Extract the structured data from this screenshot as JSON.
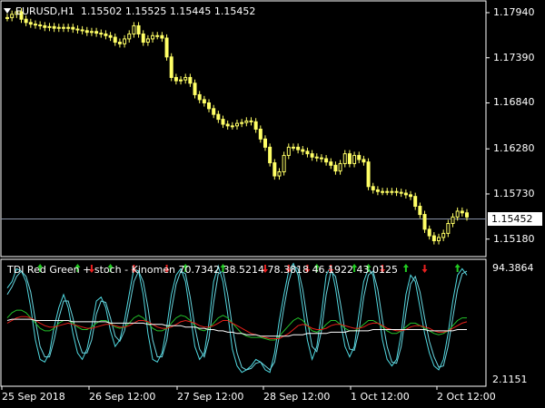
{
  "header": {
    "symbol_timeframe": "EURUSD,H1",
    "ohlc": "1.15502 1.15525 1.15445 1.15452",
    "current_price": "1.15452"
  },
  "price_axis": {
    "ticks": [
      "1.17940",
      "1.17390",
      "1.16840",
      "1.16280",
      "1.15730",
      "1.15180"
    ]
  },
  "indicator": {
    "title": "TDI Red Green + stoch - Kinomen 70.7342 38.5214 78.3818 46.1922 43.0125",
    "axis_top": "94.3864",
    "axis_bottom": "2.1151"
  },
  "time_axis": {
    "labels": [
      "25 Sep 2018",
      "26 Sep 12:00",
      "27 Sep 12:00",
      "28 Sep 12:00",
      "1 Oct 12:00",
      "2 Oct 12:00"
    ]
  },
  "colors": {
    "background": "#000000",
    "candles": "#ffff66",
    "fast_line": "#4fd8e0",
    "slow_line": "#6ad6e0",
    "green_line": "#22c22a",
    "red_line": "#e8201a",
    "white_line": "#ffffff",
    "up_arrow": "#22cc22",
    "down_arrow": "#e82020"
  },
  "chart_data": {
    "type": "candlestick",
    "symbol": "EURUSD",
    "timeframe": "H1",
    "close_series": [
      1.1788,
      1.1792,
      1.1795,
      1.1786,
      1.1782,
      1.178,
      1.1779,
      1.1778,
      1.1776,
      1.1777,
      1.1775,
      1.1776,
      1.1775,
      1.1776,
      1.1774,
      1.1773,
      1.1772,
      1.177,
      1.1771,
      1.1769,
      1.1768,
      1.1766,
      1.1764,
      1.1758,
      1.1756,
      1.1762,
      1.1768,
      1.1778,
      1.1768,
      1.1758,
      1.1762,
      1.1766,
      1.1766,
      1.1763,
      1.174,
      1.1715,
      1.1711,
      1.1712,
      1.1715,
      1.1708,
      1.1694,
      1.1688,
      1.1684,
      1.1677,
      1.167,
      1.1664,
      1.1658,
      1.1656,
      1.1656,
      1.1659,
      1.166,
      1.1662,
      1.1661,
      1.1652,
      1.164,
      1.163,
      1.1611,
      1.1595,
      1.16,
      1.162,
      1.163,
      1.163,
      1.1627,
      1.1625,
      1.1622,
      1.1618,
      1.1617,
      1.1616,
      1.1612,
      1.1608,
      1.1601,
      1.161,
      1.1622,
      1.161,
      1.162,
      1.1615,
      1.1612,
      1.1582,
      1.1578,
      1.1576,
      1.1576,
      1.1576,
      1.1576,
      1.1575,
      1.1574,
      1.1572,
      1.157,
      1.1558,
      1.1548,
      1.153,
      1.1522,
      1.1516,
      1.152,
      1.1525,
      1.1537,
      1.1545,
      1.1552,
      1.155,
      1.1545
    ],
    "down_arrow_indices": [
      18,
      27,
      34,
      55,
      60,
      64,
      69,
      80,
      89
    ],
    "up_arrow_indices": [
      7,
      15,
      22,
      38,
      46,
      66,
      74,
      77,
      85,
      96
    ],
    "series": [
      {
        "name": "stoch_fast",
        "values": [
          75,
          80,
          90,
          88,
          80,
          60,
          35,
          20,
          18,
          25,
          45,
          60,
          70,
          60,
          40,
          25,
          20,
          28,
          45,
          65,
          68,
          60,
          42,
          30,
          35,
          50,
          70,
          90,
          88,
          70,
          40,
          20,
          18,
          25,
          45,
          70,
          85,
          90,
          80,
          55,
          30,
          20,
          25,
          48,
          80,
          92,
          80,
          55,
          28,
          15,
          10,
          12,
          15,
          20,
          18,
          12,
          10,
          25,
          50,
          70,
          88,
          94,
          85,
          60,
          35,
          20,
          30,
          55,
          85,
          92,
          75,
          50,
          30,
          22,
          30,
          55,
          80,
          90,
          85,
          60,
          35,
          20,
          15,
          20,
          40,
          70,
          85,
          80,
          60,
          40,
          25,
          15,
          12,
          20,
          40,
          65,
          85,
          90,
          85
        ]
      },
      {
        "name": "stoch_slow",
        "values": [
          70,
          76,
          84,
          88,
          84,
          72,
          50,
          30,
          22,
          22,
          35,
          52,
          65,
          65,
          52,
          36,
          25,
          25,
          35,
          55,
          65,
          64,
          52,
          38,
          34,
          42,
          60,
          80,
          88,
          80,
          60,
          35,
          22,
          22,
          35,
          58,
          78,
          88,
          86,
          68,
          45,
          28,
          22,
          36,
          64,
          86,
          88,
          70,
          45,
          25,
          14,
          12,
          13,
          17,
          18,
          15,
          12,
          18,
          38,
          60,
          80,
          92,
          90,
          74,
          50,
          30,
          26,
          42,
          70,
          88,
          84,
          64,
          42,
          28,
          27,
          42,
          68,
          85,
          88,
          74,
          50,
          30,
          18,
          17,
          30,
          56,
          78,
          84,
          72,
          52,
          34,
          22,
          14,
          15,
          30,
          52,
          74,
          86,
          88
        ]
      },
      {
        "name": "green",
        "values": [
          52,
          56,
          58,
          58,
          56,
          52,
          48,
          44,
          42,
          42,
          44,
          48,
          50,
          50,
          48,
          45,
          43,
          43,
          45,
          48,
          50,
          50,
          48,
          45,
          44,
          45,
          48,
          52,
          54,
          52,
          48,
          44,
          42,
          42,
          44,
          48,
          52,
          54,
          53,
          50,
          46,
          43,
          42,
          44,
          48,
          52,
          54,
          52,
          48,
          44,
          40,
          38,
          37,
          37,
          37,
          36,
          35,
          35,
          38,
          42,
          46,
          50,
          52,
          50,
          46,
          42,
          41,
          43,
          47,
          50,
          50,
          47,
          44,
          42,
          42,
          44,
          47,
          50,
          50,
          48,
          45,
          42,
          40,
          40,
          42,
          45,
          48,
          48,
          46,
          44,
          42,
          40,
          39,
          40,
          42,
          46,
          50,
          52,
          52
        ]
      },
      {
        "name": "red",
        "values": [
          48,
          50,
          52,
          53,
          53,
          52,
          50,
          48,
          46,
          45,
          45,
          46,
          47,
          48,
          47,
          46,
          45,
          44,
          44,
          45,
          46,
          47,
          47,
          46,
          45,
          45,
          46,
          48,
          50,
          50,
          49,
          47,
          45,
          44,
          44,
          45,
          47,
          49,
          50,
          49,
          48,
          46,
          45,
          45,
          46,
          48,
          50,
          50,
          48,
          46,
          44,
          42,
          40,
          39,
          38,
          37,
          36,
          36,
          36,
          38,
          40,
          43,
          46,
          47,
          46,
          44,
          43,
          43,
          44,
          46,
          47,
          47,
          46,
          45,
          44,
          44,
          45,
          47,
          48,
          48,
          46,
          44,
          43,
          42,
          42,
          43,
          45,
          46,
          46,
          45,
          44,
          42,
          41,
          41,
          42,
          44,
          46,
          48,
          49
        ]
      },
      {
        "name": "white",
        "values": [
          50,
          51,
          51,
          51,
          51,
          51,
          50,
          50,
          50,
          50,
          50,
          50,
          50,
          50,
          49,
          49,
          49,
          49,
          49,
          49,
          49,
          49,
          48,
          48,
          48,
          48,
          48,
          48,
          48,
          48,
          47,
          47,
          47,
          47,
          46,
          46,
          46,
          46,
          45,
          45,
          45,
          44,
          44,
          43,
          43,
          42,
          42,
          41,
          41,
          40,
          40,
          39,
          39,
          39,
          38,
          38,
          38,
          38,
          38,
          38,
          38,
          39,
          39,
          39,
          40,
          40,
          40,
          40,
          40,
          41,
          41,
          41,
          41,
          42,
          42,
          42,
          42,
          42,
          43,
          43,
          43,
          43,
          43,
          43,
          43,
          43,
          43,
          43,
          43,
          43,
          42,
          42,
          42,
          42,
          42,
          42,
          43,
          43,
          43
        ]
      }
    ],
    "indicator_ylim": [
      2.1151,
      94.3864
    ],
    "price_ylim": [
      1.15,
      1.1805
    ]
  }
}
